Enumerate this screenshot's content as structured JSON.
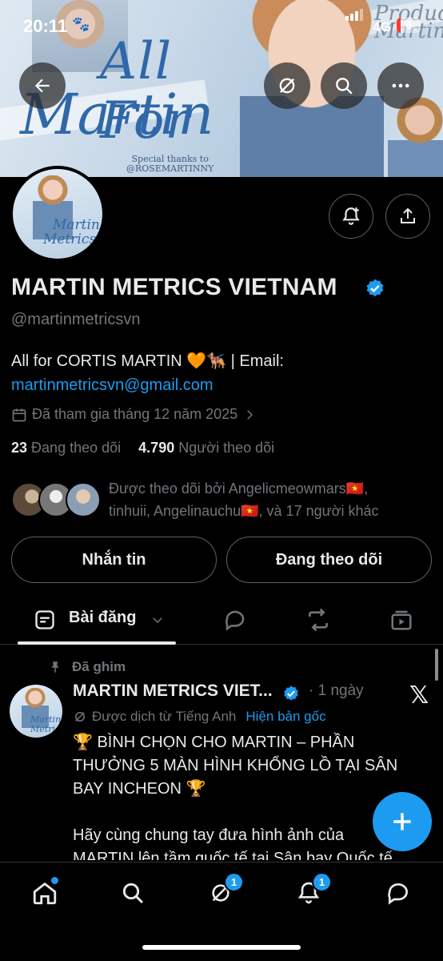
{
  "status_bar": {
    "time": "20:11",
    "network": "4G",
    "battery": "6"
  },
  "banner": {
    "title_line1": "All For",
    "title_line2": "Martin",
    "corner_text": "Produce Martin",
    "thanks_line1": "Special thanks to",
    "thanks_line2": "@ROSEMARTINNY"
  },
  "profile": {
    "name": "MARTIN METRICS VIETNAM",
    "handle": "@martinmetricsvn",
    "bio_text": "All for CORTIS MARTIN 🧡🐕‍🦺 | Email:",
    "bio_link": "martinmetricsvn@gmail.com",
    "joined": "Đã tham gia tháng 12 năm 2025",
    "following_count": "23",
    "following_label": "Đang theo dõi",
    "followers_count": "4.790",
    "followers_label": "Người theo dõi",
    "followed_by_line1": "Được theo dõi bởi Angelicmeowmars🇻🇳,",
    "followed_by_line2": "tinhuii, Angelinauchu🇻🇳, và 17 người khác",
    "avatar_text1": "Martin",
    "avatar_text2": "Metrics"
  },
  "actions": {
    "message": "Nhắn tin",
    "following": "Đang theo dõi"
  },
  "tabs": {
    "posts": "Bài đăng"
  },
  "tweet": {
    "pinned": "Đã ghim",
    "author": "MARTIN METRICS VIET...",
    "time": "· 1 ngày",
    "translated": "Được dịch từ Tiếng Anh",
    "show_original": "Hiện bản gốc",
    "line1": "🏆 BÌNH CHỌN CHO MARTIN – PHẦN",
    "line2": "THƯỞNG 5 MÀN HÌNH KHỔNG LỒ TẠI SÂN",
    "line3": "BAY INCHEON 🏆",
    "line4": "Hãy cùng chung tay đưa hình ảnh của",
    "line5": "MARTIN lên tầm quốc tế tại Sân bay Quốc tế",
    "avatar_text": "Martin Metrics"
  },
  "bottom_nav": {
    "messages_badge": "1",
    "notifications_badge": "1"
  },
  "colors": {
    "accent": "#1d9bf0",
    "background": "#000000",
    "muted": "#71767b"
  }
}
